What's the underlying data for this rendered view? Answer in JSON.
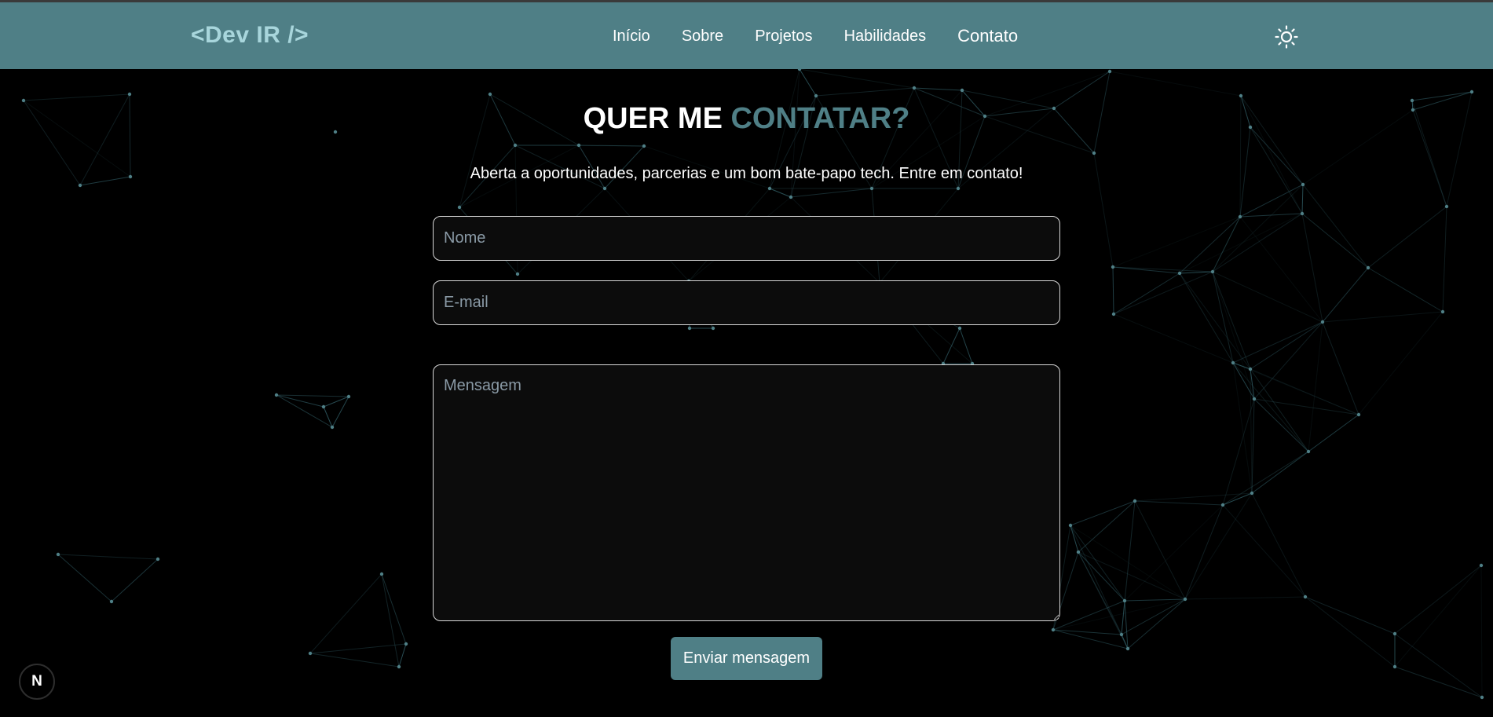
{
  "header": {
    "logo": "<Dev IR />",
    "nav": [
      "Início",
      "Sobre",
      "Projetos",
      "Habilidades",
      "Contato"
    ],
    "active_nav": "Contato",
    "theme_icon": "sun-icon"
  },
  "contact": {
    "title_main": "QUER ME",
    "title_accent": "CONTATAR?",
    "subtitle": "Aberta a oportunidades, parcerias e um bom bate-papo tech. Entre em contato!",
    "name_placeholder": "Nome",
    "email_placeholder": "E-mail",
    "message_placeholder": "Mensagem",
    "submit_label": "Enviar mensagem"
  },
  "badge": {
    "label": "N"
  },
  "colors": {
    "accent": "#4f7f86",
    "logo": "#a8d6dc",
    "background": "#000000",
    "network_lines": "#2f5a62"
  }
}
